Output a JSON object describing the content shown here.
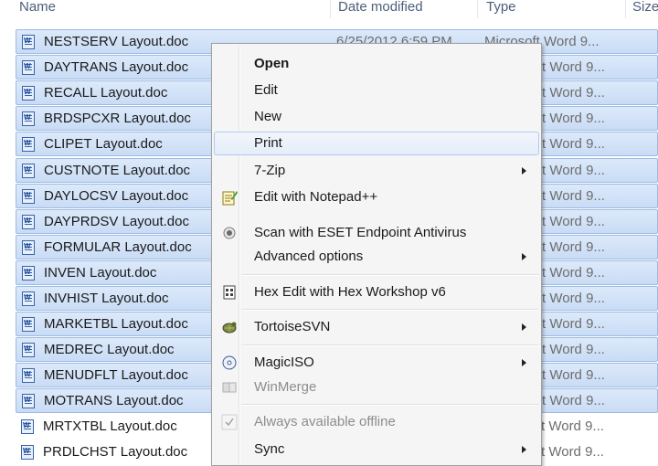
{
  "header": {
    "name": "Name",
    "date_modified": "Date modified",
    "type": "Type",
    "size": "Size"
  },
  "files": [
    {
      "name": "NESTSERV Layout.doc",
      "date": "6/25/2012 6:59 PM",
      "type": "Microsoft Word 9...",
      "selected": true
    },
    {
      "name": "DAYTRANS Layout.doc",
      "type": "t Word 9...",
      "selected": true
    },
    {
      "name": "RECALL Layout.doc",
      "type": "t Word 9...",
      "selected": true
    },
    {
      "name": "BRDSPCXR Layout.doc",
      "type": "t Word 9...",
      "selected": true
    },
    {
      "name": "CLIPET Layout.doc",
      "type": "t Word 9...",
      "selected": true
    },
    {
      "name": "CUSTNOTE Layout.doc",
      "type": "t Word 9...",
      "selected": true
    },
    {
      "name": "DAYLOCSV Layout.doc",
      "type": "t Word 9...",
      "selected": true
    },
    {
      "name": "DAYPRDSV Layout.doc",
      "type": "t Word 9...",
      "selected": true
    },
    {
      "name": "FORMULAR Layout.doc",
      "type": "t Word 9...",
      "selected": true
    },
    {
      "name": "INVEN Layout.doc",
      "type": "t Word 9...",
      "selected": true
    },
    {
      "name": "INVHIST Layout.doc",
      "type": "t Word 9...",
      "selected": true
    },
    {
      "name": "MARKETBL Layout.doc",
      "type": "t Word 9...",
      "selected": true
    },
    {
      "name": "MEDREC Layout.doc",
      "type": "t Word 9...",
      "selected": true
    },
    {
      "name": "MENUDFLT Layout.doc",
      "type": "t Word 9...",
      "selected": true
    },
    {
      "name": "MOTRANS Layout.doc",
      "type": "t Word 9...",
      "selected": true
    },
    {
      "name": "MRTXTBL Layout.doc",
      "type": "t Word 9...",
      "selected": false
    },
    {
      "name": "PRDLCHST Layout.doc",
      "type": "t Word 9...",
      "selected": false
    }
  ],
  "context_menu": {
    "open": "Open",
    "edit": "Edit",
    "new": "New",
    "print": "Print",
    "seven_zip": "7-Zip",
    "edit_notepad": "Edit with Notepad++",
    "scan_eset": "Scan with ESET Endpoint Antivirus",
    "advanced_options": "Advanced options",
    "hex_edit": "Hex Edit with Hex Workshop v6",
    "tortoise_svn": "TortoiseSVN",
    "magic_iso": "MagicISO",
    "winmerge": "WinMerge",
    "always_offline": "Always available offline",
    "sync": "Sync",
    "hovered_item": "Print"
  },
  "icons": {
    "file": "word-document-icon",
    "notepad": "notepad-plus-plus-icon",
    "eset": "eset-antivirus-icon",
    "hex": "hex-workshop-icon",
    "svn": "tortoise-svn-icon",
    "magiciso": "magiciso-icon",
    "winmerge": "winmerge-icon",
    "offline": "checkmark-icon",
    "submenu": "submenu-arrow-icon"
  },
  "colors": {
    "selection_fill": "#c9dcf5",
    "selection_border": "#9bbbe3",
    "menu_bg": "#f5f5f5",
    "hover_border": "#aeccf1"
  }
}
